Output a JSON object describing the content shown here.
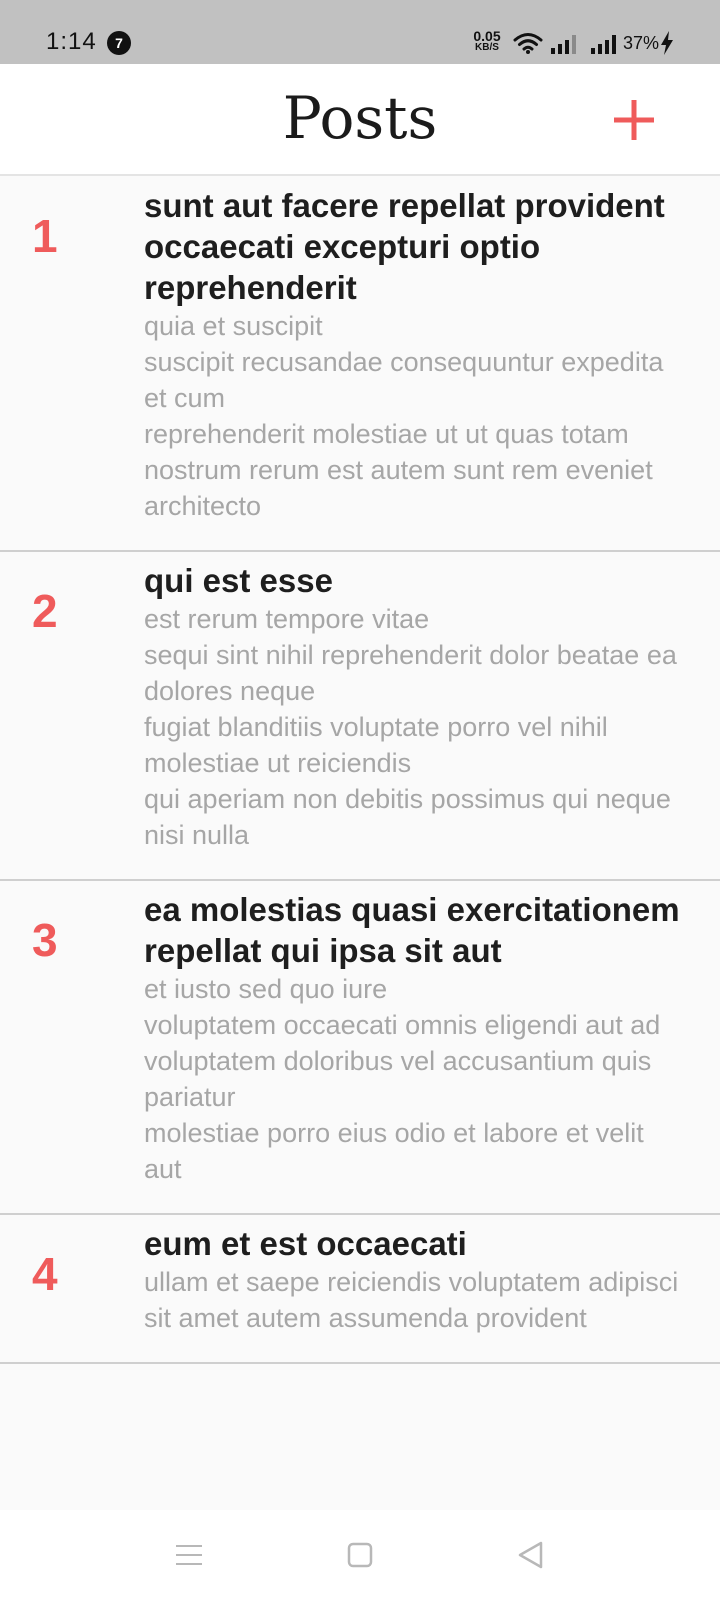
{
  "status_bar": {
    "time": "1:14",
    "notification_count": "7",
    "net_speed_value": "0.05",
    "net_speed_unit": "KB/S",
    "battery": "37%"
  },
  "header": {
    "title": "Posts",
    "add_icon": "plus-icon"
  },
  "colors": {
    "accent": "#ef5b5b",
    "title_text": "#1e1e1e",
    "body_text": "#a6a6a6",
    "status_bar_bg": "#c1c1c1"
  },
  "posts": [
    {
      "number": "1",
      "title": "sunt aut facere repellat provident occaecati excepturi optio reprehenderit",
      "body": "quia et suscipit\nsuscipit recusandae consequuntur expedita et cum\nreprehenderit molestiae ut ut quas totam\nnostrum rerum est autem sunt rem eveniet architecto"
    },
    {
      "number": "2",
      "title": "qui est esse",
      "body": "est rerum tempore vitae\nsequi sint nihil reprehenderit dolor beatae ea dolores neque\nfugiat blanditiis voluptate porro vel nihil molestiae ut reiciendis\nqui aperiam non debitis possimus qui neque nisi nulla"
    },
    {
      "number": "3",
      "title": "ea molestias quasi exercitationem repellat qui ipsa sit aut",
      "body": "et iusto sed quo iure\nvoluptatem occaecati omnis eligendi aut ad\nvoluptatem doloribus vel accusantium quis pariatur\nmolestiae porro eius odio et labore et velit aut"
    },
    {
      "number": "4",
      "title": "eum et est occaecati",
      "body": "ullam et saepe reiciendis voluptatem adipisci\nsit amet autem assumenda provident"
    }
  ],
  "nav_bar": {
    "menu_icon": "menu-icon",
    "home_icon": "square-home-icon",
    "back_icon": "triangle-back-icon"
  }
}
